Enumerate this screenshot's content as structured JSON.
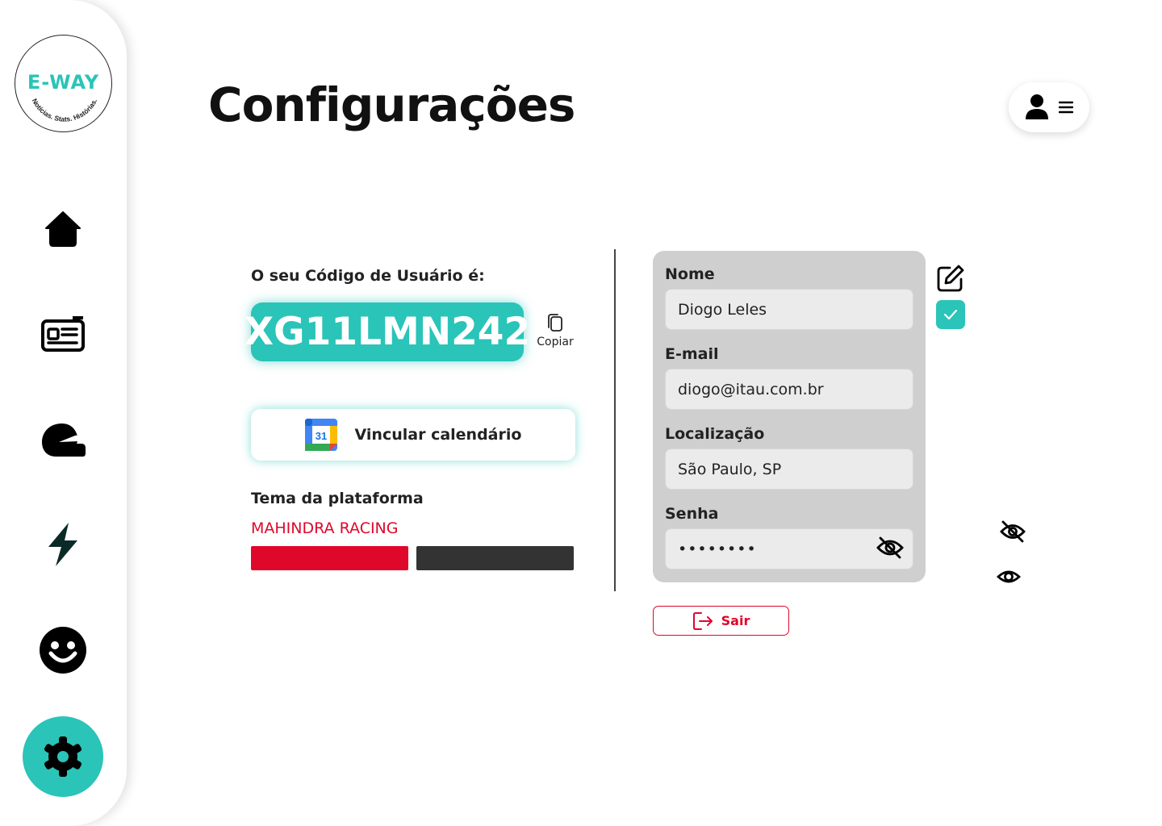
{
  "brand": {
    "name": "E-WAY",
    "tagline": "Notícias. Stats. Histórias.",
    "accent": "#2ac4b8"
  },
  "sidebar": {
    "items": [
      {
        "icon": "home-icon"
      },
      {
        "icon": "news-icon"
      },
      {
        "icon": "helmet-icon"
      },
      {
        "icon": "bolt-icon"
      },
      {
        "icon": "smile-icon"
      },
      {
        "icon": "gear-icon",
        "active": true
      }
    ]
  },
  "header": {
    "title": "Configurações",
    "user_menu_icons": [
      "user-icon",
      "menu-icon"
    ]
  },
  "code": {
    "label": "O seu Código de Usuário é:",
    "value": "XG11LMN242",
    "copy_label": "Copiar"
  },
  "calendar": {
    "label": "Vincular calendário",
    "icon_day": "31"
  },
  "theme": {
    "label": "Tema da plataforma",
    "name": "MAHINDRA RACING",
    "swatches": [
      "#df072a",
      "#333333"
    ]
  },
  "form": {
    "name_label": "Nome",
    "name_value": "Diogo Leles",
    "email_label": "E-mail",
    "email_value": "diogo@itau.com.br",
    "location_label": "Localização",
    "location_value": "São Paulo, SP",
    "password_label": "Senha",
    "password_value": "••••••••"
  },
  "logout": {
    "label": "Sair"
  }
}
